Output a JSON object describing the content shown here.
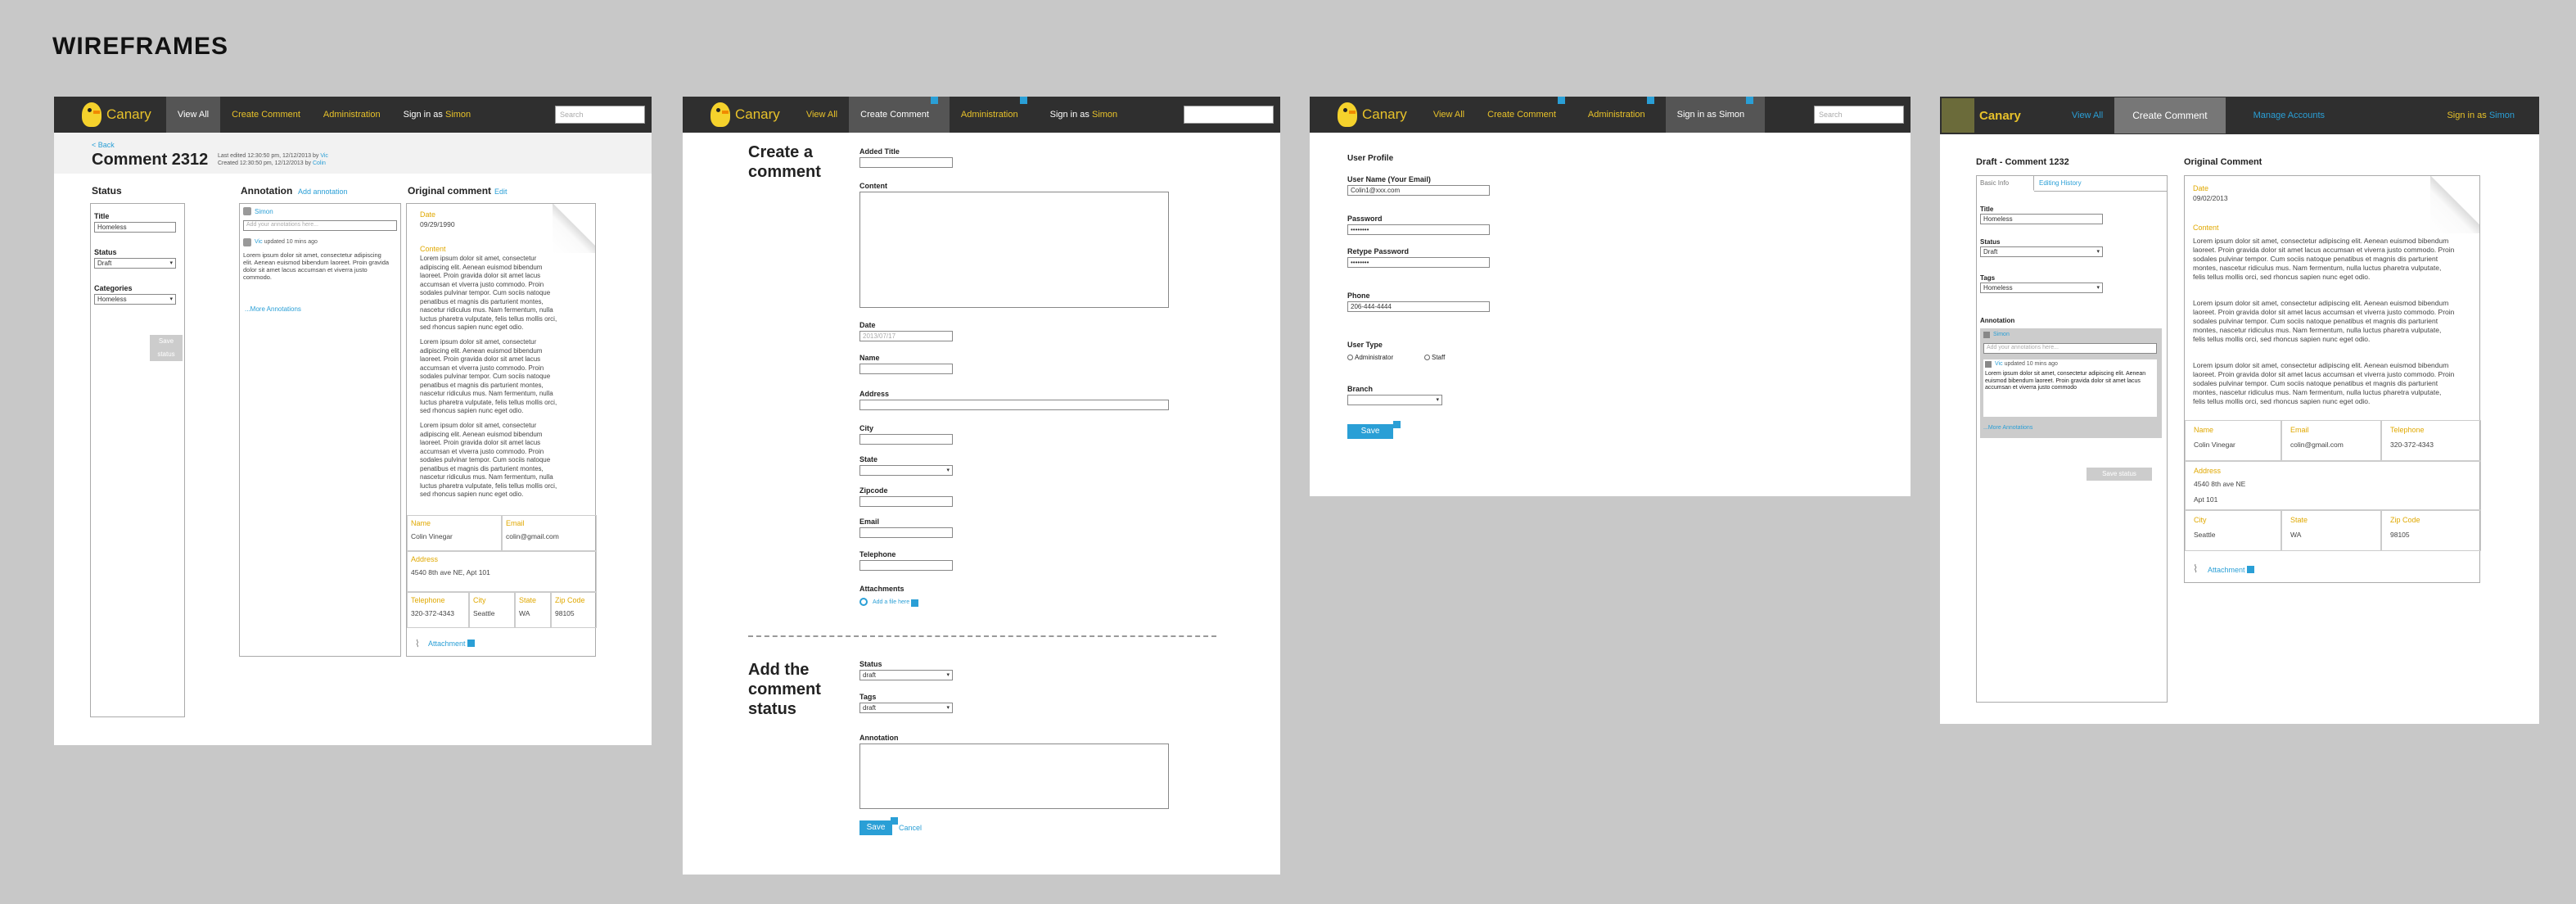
{
  "heading": "WIREFRAMES",
  "brand": {
    "name": "Canary",
    "accent": "#e8c22a",
    "link": "#2a9fd6",
    "navbar": "#2f2f2f"
  },
  "frame1": {
    "nav": {
      "view_all": "View All",
      "create": "Create Comment",
      "admin": "Administration",
      "signin": "Sign in as",
      "user": "Simon",
      "search": "Search"
    },
    "back": "< Back",
    "title": "Comment 2312",
    "meta1": "Last edited 12:30:50 pm, 12/12/2013 by",
    "meta1_user": "Vic",
    "meta2": "Created 12:30:50 pm, 12/12/2013 by",
    "meta2_user": "Colin",
    "status_heading": "Status",
    "title_label": "Title",
    "title_value": "Homeless",
    "status_label": "Status",
    "status_value": "Draft",
    "categories_label": "Categories",
    "categories_value": "Homeless",
    "save_btn": "Save status",
    "annotation_heading": "Annotation",
    "add_annotation": "Add annotation",
    "ann_user": "Simon",
    "ann_placeholder": "Add your annotations here...",
    "ann_user2": "Vic",
    "ann_updated": "updated 10 mins ago",
    "ann_text": "Lorem ipsum dolor sit amet, consectetur adipiscing elit. Aenean euismod bibendum laoreet. Proin gravida dolor sit amet lacus accumsan et viverra justo commodo.",
    "more_ann": "...More Annotations",
    "orig_heading": "Original comment",
    "edit": "Edit",
    "date_label": "Date",
    "date_value": "09/29/1990",
    "content_label": "Content",
    "lorem": "Lorem ipsum dolor sit amet, consectetur adipiscing elit. Aenean euismod bibendum laoreet. Proin gravida dolor sit amet lacus accumsan et viverra justo commodo. Proin sodales pulvinar tempor. Cum sociis natoque penatibus et magnis dis parturient montes, nascetur ridiculus mus. Nam fermentum, nulla luctus pharetra vulputate, felis tellus mollis orci, sed rhoncus sapien nunc eget odio.",
    "name_label": "Name",
    "name_value": "Colin Vinegar",
    "email_label": "Email",
    "email_value": "colin@gmail.com",
    "address_label": "Address",
    "address_value": "4540 8th ave NE, Apt 101",
    "tel_label": "Telephone",
    "tel_value": "320-372-4343",
    "city_label": "City",
    "city_value": "Seattle",
    "state_label": "State",
    "state_value": "WA",
    "zip_label": "Zip Code",
    "zip_value": "98105",
    "attachment": "Attachment"
  },
  "frame2": {
    "nav": {
      "view_all": "View All",
      "create": "Create Comment",
      "admin": "Administration",
      "signin": "Sign in as",
      "user": "Simon"
    },
    "section1": "Create a comment",
    "added_title": "Added Title",
    "content": "Content",
    "date": "Date",
    "date_value": "2013/07/17",
    "name": "Name",
    "address": "Address",
    "city": "City",
    "state": "State",
    "zipcode": "Zipcode",
    "email": "Email",
    "telephone": "Telephone",
    "attachments": "Attachments",
    "add_file": "Add a file here",
    "section2": "Add the comment status",
    "status": "Status",
    "status_value": "draft",
    "tags": "Tags",
    "tags_value": "draft",
    "annotation": "Annotation",
    "save": "Save",
    "cancel": "Cancel"
  },
  "frame3": {
    "nav": {
      "view_all": "View All",
      "create": "Create Comment",
      "admin": "Administration",
      "signin": "Sign in as",
      "user": "Simon",
      "search": "Search"
    },
    "title": "User Profile",
    "username_label": "User Name (Your Email)",
    "username_value": "Colin1@xxx.com",
    "password_label": "Password",
    "password_value": "••••••••",
    "retype_label": "Retype Password",
    "retype_value": "••••••••",
    "phone_label": "Phone",
    "phone_value": "206-444-4444",
    "usertype_label": "User Type",
    "opt_admin": "Administrator",
    "opt_staff": "Staff",
    "branch_label": "Branch",
    "save": "Save"
  },
  "frame4": {
    "nav": {
      "view_all": "View All",
      "create": "Create Comment",
      "manage": "Manage Accounts",
      "signin": "Sign in as",
      "user": "Simon"
    },
    "draft_title": "Draft - Comment 1232",
    "tab_basic": "Basic Info",
    "tab_history": "Editing History",
    "title_label": "Title",
    "title_value": "Homeless",
    "status_label": "Status",
    "status_value": "Draft",
    "tags_label": "Tags",
    "tags_value": "Homeless",
    "annotation_label": "Annotation",
    "ann_user": "Simon",
    "ann_placeholder": "Add your annotations here...",
    "ann_user2": "Vic",
    "ann_updated": "updated 10 mins ago",
    "ann_text": "Lorem ipsum dolor sit amet, consectetur adipiscing elit. Aenean euismod bibendum laoreet. Proin gravida dolor sit amet lacus accumsan et viverra justo commodo",
    "more_ann": "...More Annotations",
    "save_btn": "Save status",
    "orig_heading": "Original Comment",
    "date_label": "Date",
    "date_value": "09/02/2013",
    "content_label": "Content",
    "lorem": "Lorem ipsum dolor sit amet, consectetur adipiscing elit. Aenean euismod bibendum laoreet. Proin gravida dolor sit amet lacus accumsan et viverra justo commodo. Proin sodales pulvinar tempor. Cum sociis natoque penatibus et magnis dis parturient montes, nascetur ridiculus mus. Nam fermentum, nulla luctus pharetra vulputate, felis tellus mollis orci, sed rhoncus sapien nunc eget odio.",
    "name_label": "Name",
    "name_value": "Colin Vinegar",
    "email_label": "Email",
    "email_value": "colin@gmail.com",
    "tel_label": "Telephone",
    "tel_value": "320-372-4343",
    "address_label": "Address",
    "address_value": "4540 8th ave NE",
    "address_value2": "Apt 101",
    "city_label": "City",
    "city_value": "Seattle",
    "state_label": "State",
    "state_value": "WA",
    "zip_label": "Zip Code",
    "zip_value": "98105",
    "attachment": "Attachment"
  }
}
